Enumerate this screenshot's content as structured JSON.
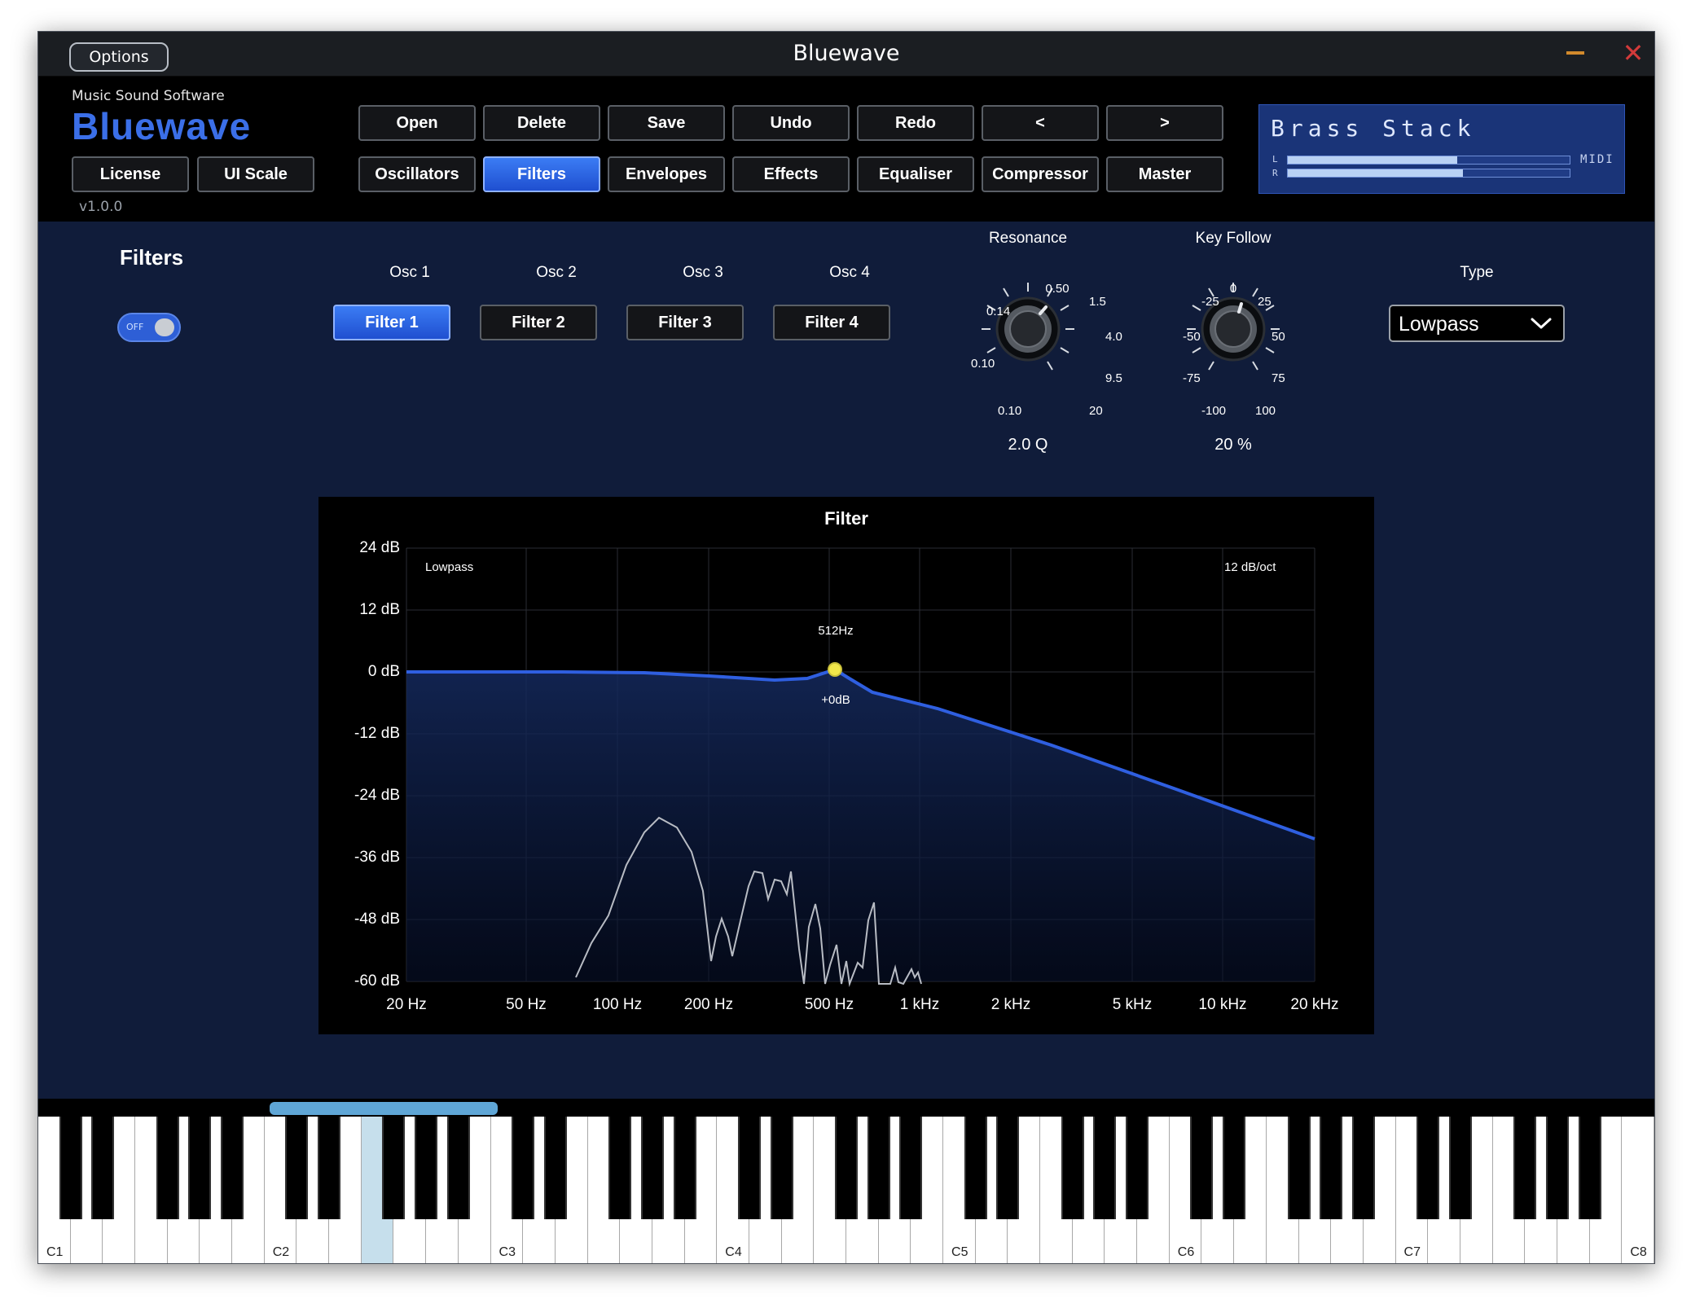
{
  "window": {
    "title": "Bluewave",
    "options_label": "Options",
    "min_symbol": "—",
    "close_symbol": "✕"
  },
  "brand": {
    "subtitle": "Music Sound Software",
    "name": "Bluewave",
    "version": "v1.0.0",
    "license_label": "License",
    "ui_scale_label": "UI Scale"
  },
  "toolbar": {
    "row1": [
      "Open",
      "Delete",
      "Save",
      "Undo",
      "Redo",
      "<",
      ">"
    ],
    "row2": [
      "Oscillators",
      "Filters",
      "Envelopes",
      "Effects",
      "Equaliser",
      "Compressor",
      "Master"
    ],
    "active_tab": "Filters"
  },
  "preset": {
    "name": "Brass Stack",
    "meter_l_label": "L",
    "meter_r_label": "R",
    "meter_l_level": 0.6,
    "meter_r_level": 0.62,
    "midi_label": "MIDI"
  },
  "filters": {
    "section_title": "Filters",
    "toggle_state": "OFF",
    "osc_labels": [
      "Osc 1",
      "Osc 2",
      "Osc 3",
      "Osc 4"
    ],
    "filter_buttons": [
      "Filter 1",
      "Filter 2",
      "Filter 3",
      "Filter 4"
    ],
    "active_filter": "Filter 1",
    "resonance": {
      "title": "Resonance",
      "ticks": [
        "0.10",
        "0.10",
        "0.14",
        "0.50",
        "1.5",
        "4.0",
        "9.5",
        "20"
      ],
      "value": "2.0 Q"
    },
    "key_follow": {
      "title": "Key Follow",
      "ticks": [
        "-100",
        "-75",
        "-50",
        "-25",
        "0",
        "25",
        "50",
        "75",
        "100"
      ],
      "value": "20 %"
    },
    "type": {
      "title": "Type",
      "value": "Lowpass"
    }
  },
  "graph": {
    "title": "Filter",
    "mode_label": "Lowpass",
    "slope_label": "12 dB/oct",
    "marker_freq_label": "512Hz",
    "marker_gain_label": "+0dB",
    "y_ticks": [
      "24 dB",
      "12 dB",
      "0 dB",
      "-12 dB",
      "-24 dB",
      "-36 dB",
      "-48 dB",
      "-60 dB"
    ],
    "x_ticks": [
      "20 Hz",
      "50 Hz",
      "100 Hz",
      "200 Hz",
      "500 Hz",
      "1 kHz",
      "2 kHz",
      "5 kHz",
      "10 kHz",
      "20 kHz"
    ],
    "curve_color": "#2f5fe0",
    "spectrum_color": "#b8bcc4",
    "marker_color": "#f2e84a"
  },
  "keyboard": {
    "octave_labels": [
      "C1",
      "C2",
      "C3",
      "C4",
      "C5",
      "C6",
      "C7",
      "C8"
    ],
    "pressed_note": "C2 + 5 (F2)"
  }
}
